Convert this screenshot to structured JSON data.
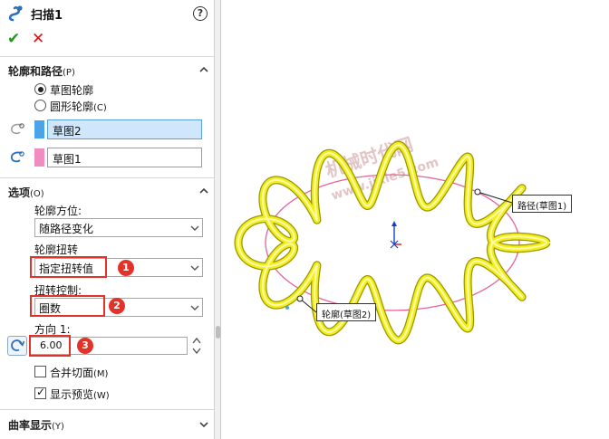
{
  "property_manager": {
    "feature_title": "扫描1",
    "help_glyph": "?",
    "confirm_glyph": "✔",
    "cancel_glyph": "✕"
  },
  "profile_path": {
    "title": "轮廓和路径",
    "hotkey": "(P)",
    "options": [
      {
        "label": "草图轮廓",
        "hotkey": "",
        "selected": true
      },
      {
        "label": "圆形轮廓",
        "hotkey": "(C)",
        "selected": false
      }
    ],
    "profile_selection": {
      "value": "草图2",
      "chip_color": "#4da3ea"
    },
    "path_selection": {
      "value": "草图1",
      "chip_color": "#f08cc0"
    }
  },
  "options": {
    "title": "选项",
    "hotkey": "(O)",
    "orientation_label": "轮廓方位:",
    "orientation_value": "随路径变化",
    "twist_label": "轮廓扭转",
    "twist_value": "指定扭转值",
    "twist_control_label": "扭转控制:",
    "twist_control_value": "圈数",
    "direction_label": "方向 1:",
    "direction_value": "6.00",
    "merge_faces": {
      "label": "合并切面",
      "hotkey": "(M)",
      "checked": false
    },
    "show_preview": {
      "label": "显示预览",
      "hotkey": "(W)",
      "checked": true
    }
  },
  "curvature": {
    "title": "曲率显示",
    "hotkey": "(Y)"
  },
  "annotations": {
    "badge_1": "1",
    "badge_2": "2",
    "badge_3": "3",
    "highlight_color": "#e2332a"
  },
  "viewport": {
    "path_callout": "路径(草图1)",
    "profile_callout": "轮廓(草图2)",
    "watermark_line1": "机械时代网",
    "watermark_line2": "www.jixie5.com",
    "sweep_color": "#f2ee1a",
    "path_color": "#e8609a"
  }
}
